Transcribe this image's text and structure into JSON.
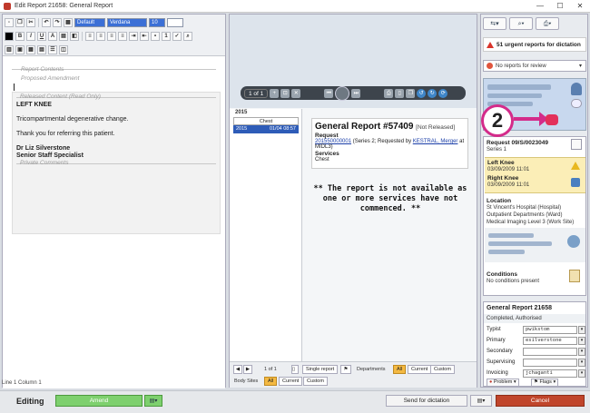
{
  "window": {
    "title": "Edit Report 21658: General Report",
    "controls": [
      "—",
      "☐",
      "✕"
    ]
  },
  "toolbar": {
    "style_select": "Default",
    "font_select": "Verdana",
    "size_select": "10"
  },
  "editor": {
    "report_contents": "Report Contents",
    "proposed_amendment": "Proposed Amendment",
    "released_content": "Released Content (Read Only)",
    "heading": "LEFT KNEE",
    "finding": "Tricompartmental degenerative change.",
    "thanks": "Thank you for referring this patient.",
    "doctor": "Dr Liz Silverstone",
    "doctor_title": "Senior Staff Specialist",
    "private_comments": "Private Comments",
    "status_line": "Line 1 Column 1"
  },
  "viewer": {
    "page_indicator": "1 of 1",
    "year": "2015",
    "list_header": "Chest",
    "list_row": {
      "year": "2015",
      "date": "01/04 08:57"
    }
  },
  "report": {
    "title": "General Report #57409",
    "status": "[Not Released]",
    "request_label": "Request",
    "request_id": "201550000001",
    "request_mid": " (Series 2; Requested by ",
    "requester": "KESTRAL, Merger",
    "request_end": " at MIDL3)",
    "services_label": "Services",
    "service": "Chest",
    "notice": "** The report is not available as one or more services have not commenced. **"
  },
  "mid_footer": {
    "page": "1 of 1",
    "single_report": "Single report",
    "departments_label": "Departments",
    "body_sites_label": "Body Sites",
    "all": "All",
    "current": "Current",
    "custom": "Custom"
  },
  "right": {
    "urgent": "51 urgent reports for dictation",
    "review": "No reports for review",
    "callout_number": "2",
    "order": {
      "request": "Request 09/S/0023049",
      "series": "Series 1",
      "exams": [
        {
          "name": "Left Knee",
          "date": "03/09/2009 11:01"
        },
        {
          "name": "Right Knee",
          "date": "03/09/2009 11:01"
        }
      ],
      "location_label": "Location",
      "locations": [
        "St Vincent's Hospital (Hospital)",
        "Outpatient Departments (Ward)",
        "Medical Imaging Level 3 (Work Site)"
      ],
      "conditions_label": "Conditions",
      "conditions_value": "No conditions present"
    },
    "form": {
      "title": "General Report 21658",
      "status": "Completed, Authorised",
      "fields": [
        {
          "label": "Typist",
          "value": "pwikstom"
        },
        {
          "label": "Primary",
          "value": "esilverstone"
        },
        {
          "label": "Secondary",
          "value": ""
        },
        {
          "label": "Supervising",
          "value": ""
        },
        {
          "label": "Invoicing",
          "value": "jchaganti"
        }
      ],
      "problem": "Problem",
      "flags": "Flags"
    }
  },
  "bottom": {
    "editing": "Editing",
    "amend": "Amend",
    "send": "Send for dictation",
    "cancel": "Cancel"
  },
  "colors": {
    "amend": "#7ed06e",
    "cancel": "#c0452b",
    "callout": "#d42b8a",
    "exam_highlight": "#fbeeb7"
  }
}
